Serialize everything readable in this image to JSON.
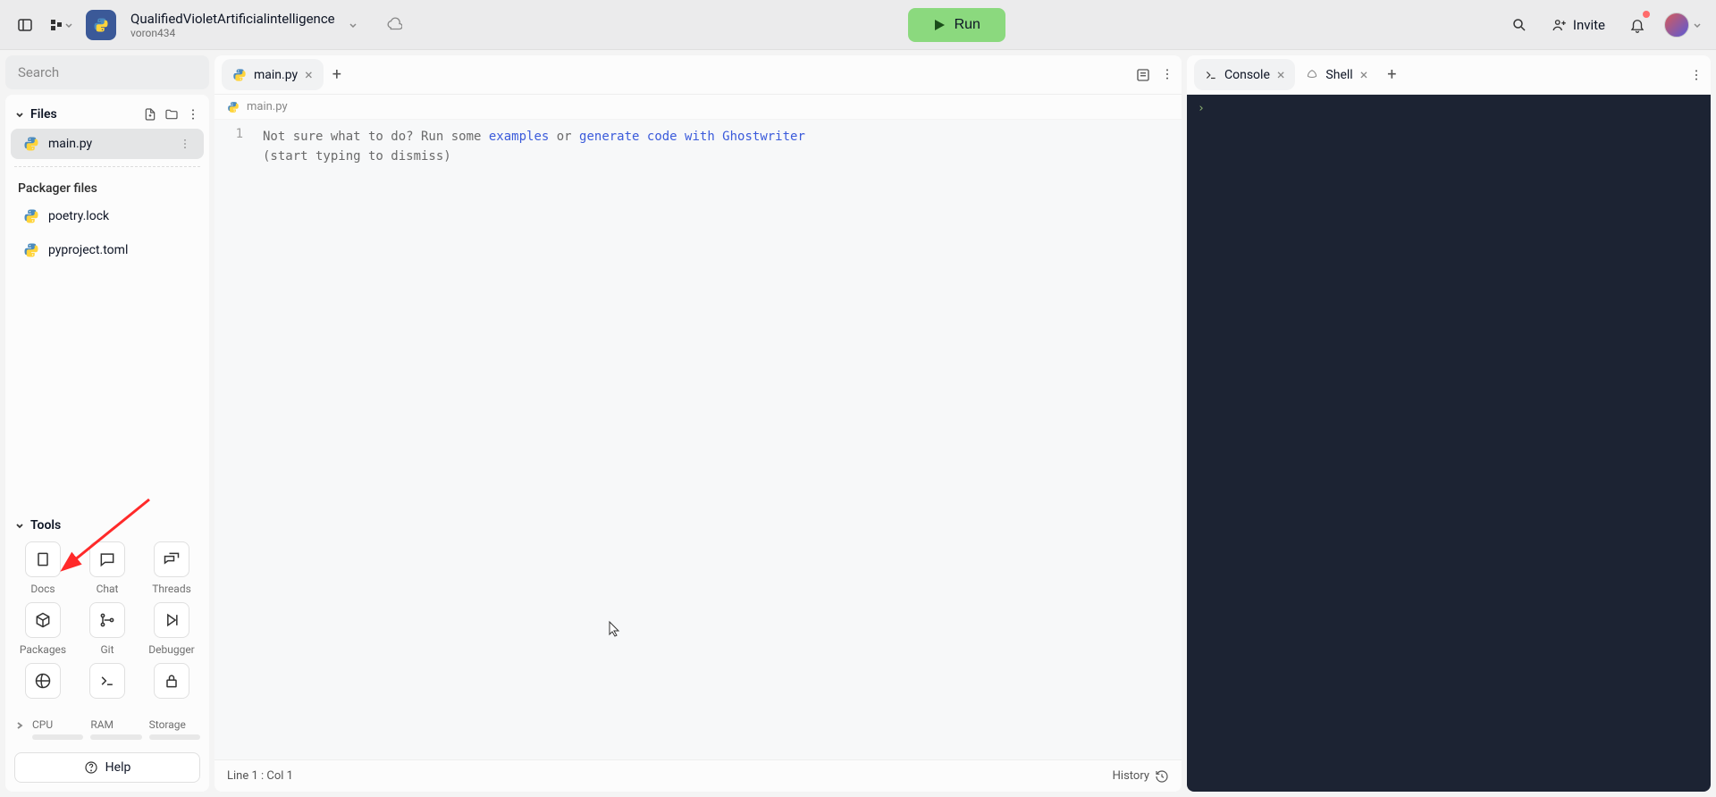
{
  "header": {
    "project_title": "QualifiedVioletArtificialintelligence",
    "project_user": "voron434",
    "run_label": "Run",
    "invite_label": "Invite"
  },
  "sidebar": {
    "search_placeholder": "Search",
    "files_label": "Files",
    "files": [
      {
        "name": "main.py",
        "active": true
      }
    ],
    "packager_label": "Packager files",
    "packager_files": [
      {
        "name": "poetry.lock"
      },
      {
        "name": "pyproject.toml"
      }
    ],
    "tools_label": "Tools",
    "tools": [
      {
        "name": "Docs",
        "icon": "docs"
      },
      {
        "name": "Chat",
        "icon": "chat"
      },
      {
        "name": "Threads",
        "icon": "threads"
      },
      {
        "name": "Packages",
        "icon": "packages"
      },
      {
        "name": "Git",
        "icon": "git"
      },
      {
        "name": "Debugger",
        "icon": "debugger"
      },
      {
        "name": "",
        "icon": "shell-alt"
      },
      {
        "name": "",
        "icon": "terminal"
      },
      {
        "name": "",
        "icon": "lock"
      }
    ],
    "resources": [
      {
        "label": "CPU"
      },
      {
        "label": "RAM"
      },
      {
        "label": "Storage"
      }
    ],
    "help_label": "Help"
  },
  "editor": {
    "tabs": [
      {
        "name": "main.py",
        "active": true
      }
    ],
    "breadcrumb": "main.py",
    "gutter": [
      "1"
    ],
    "hint_prefix": "Not sure what to do? Run some ",
    "hint_link1": "examples",
    "hint_mid": " or ",
    "hint_link2": "generate code with Ghostwriter",
    "hint_suffix": "(start typing to dismiss)",
    "status_left": "Line 1 : Col 1",
    "status_right": "History"
  },
  "right": {
    "tabs": [
      {
        "name": "Console",
        "icon": "console",
        "active": true
      },
      {
        "name": "Shell",
        "icon": "shell",
        "active": false
      }
    ],
    "prompt": "›"
  }
}
